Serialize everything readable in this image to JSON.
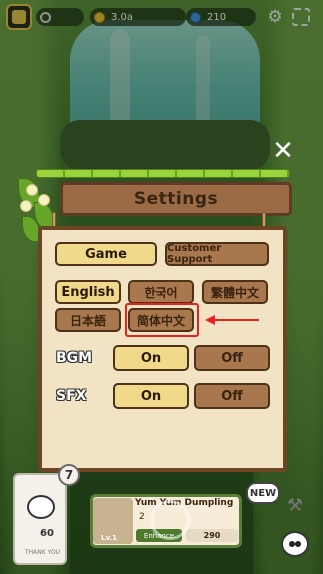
{
  "hud": {
    "coins": "3.0a",
    "gems": "210",
    "icons": [
      "avatar-icon",
      "search-icon",
      "coin-icon",
      "gem-icon",
      "gear-icon",
      "fullscreen-icon"
    ]
  },
  "settings": {
    "title": "Settings",
    "tabs": {
      "game": "Game",
      "support": "Customer Support"
    },
    "languages": {
      "english": "English",
      "korean": "한국어",
      "trad_chinese": "繁體中文",
      "japanese": "日本語",
      "simp_chinese": "简体中文"
    },
    "bgm": {
      "label": "BGM",
      "on": "On",
      "off": "Off"
    },
    "sfx": {
      "label": "SFX",
      "on": "On",
      "off": "Off"
    }
  },
  "bottom": {
    "card_level": "7",
    "card_count": "60",
    "card_sub": "THANK YOU",
    "item_title": "Yum Yum Dumpling",
    "item_qty": "2",
    "item_level": "Lv.1",
    "enhance_label": "Enhance",
    "price": "290",
    "new_badge": "NEW"
  },
  "colors": {
    "accent_highlight": "#e8221f",
    "panel_bg": "#f2e3c4",
    "gold_button": "#f0d98a",
    "brown_button": "#a8774d"
  }
}
